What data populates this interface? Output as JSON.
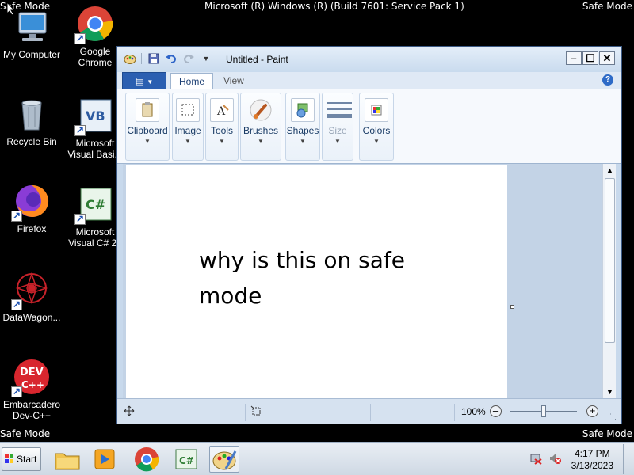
{
  "screen": {
    "safe_mode_label": "Safe Mode",
    "os_banner": "Microsoft (R) Windows (R) (Build 7601: Service Pack 1)"
  },
  "desktop_icons": [
    {
      "label": "My Computer",
      "icon": "computer-icon"
    },
    {
      "label": "Google Chrome",
      "icon": "chrome-icon"
    },
    {
      "label": "Recycle Bin",
      "icon": "recycle-bin-icon"
    },
    {
      "label": "Microsoft Visual Basi...",
      "icon": "visual-basic-icon"
    },
    {
      "label": "Firefox",
      "icon": "firefox-icon"
    },
    {
      "label": "Microsoft Visual C# 20",
      "icon": "visual-csharp-icon"
    },
    {
      "label": "DataWagon...",
      "icon": "datawagon-icon"
    },
    {
      "label": "Embarcadero Dev-C++",
      "icon": "devcpp-icon"
    }
  ],
  "paint": {
    "window_title": "Untitled - Paint",
    "tabs": {
      "home": "Home",
      "view": "View"
    },
    "ribbon": {
      "clipboard": "Clipboard",
      "image": "Image",
      "tools": "Tools",
      "brushes": "Brushes",
      "shapes": "Shapes",
      "size": "Size",
      "colors": "Colors"
    },
    "canvas_text": "why is this on safe mode",
    "zoom": "100%"
  },
  "taskbar": {
    "start_label": "Start",
    "time": "4:17 PM",
    "date": "3/13/2023"
  },
  "colors": {
    "desktop_bg": "#000000",
    "titlebar": "#c9dbee",
    "file_tab": "#2b5fb1"
  }
}
